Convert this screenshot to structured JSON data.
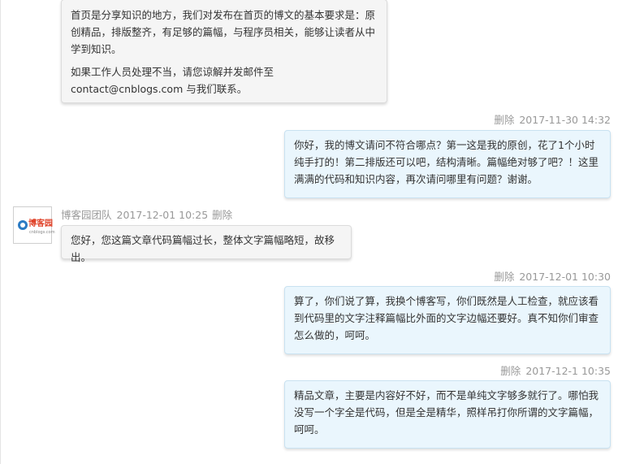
{
  "messages": [
    {
      "paragraphs": [
        "首页是分享知识的地方，我们对发布在首页的博文的基本要求是：原创精品，排版整齐，有足够的篇幅，与程序员相关，能够让读者从中学到知识。",
        "如果工作人员处理不当，请您谅解并发邮件至 contact@cnblogs.com 与我们联系。"
      ]
    },
    {
      "delete_label": "删除",
      "time": "2017-11-30 14:32",
      "text": "你好，我的博文请问不符合哪点？第一这是我的原创，花了1个小时纯手打的！第二排版还可以吧，结构清晰。篇幅绝对够了吧？！这里满满的代码和知识内容，再次请问哪里有问题？谢谢。"
    },
    {
      "author": "博客园团队",
      "time": "2017-12-01 10:25",
      "delete_label": "删除",
      "text": "您好，您这篇文章代码篇幅过长，整体文字篇幅略短，故移出。"
    },
    {
      "delete_label": "删除",
      "time": "2017-12-01 10:30",
      "text": "算了，你们说了算，我换个博客写，你们既然是人工检查，就应该看到代码里的文字注释篇幅比外面的文字边幅还要好。真不知你们审查怎么做的，呵呵。"
    },
    {
      "delete_label": "删除",
      "time": "2017-12-1 10:35",
      "text": "精品文章，主要是内容好不好，而不是单纯文字够多就行了。哪怕我没写一个字全是代码，但是全是精华，照样吊打你所谓的文字篇幅，呵呵。"
    }
  ],
  "avatar": {
    "logo_text": "博客园",
    "logo_sub": "cnblogs.com"
  }
}
